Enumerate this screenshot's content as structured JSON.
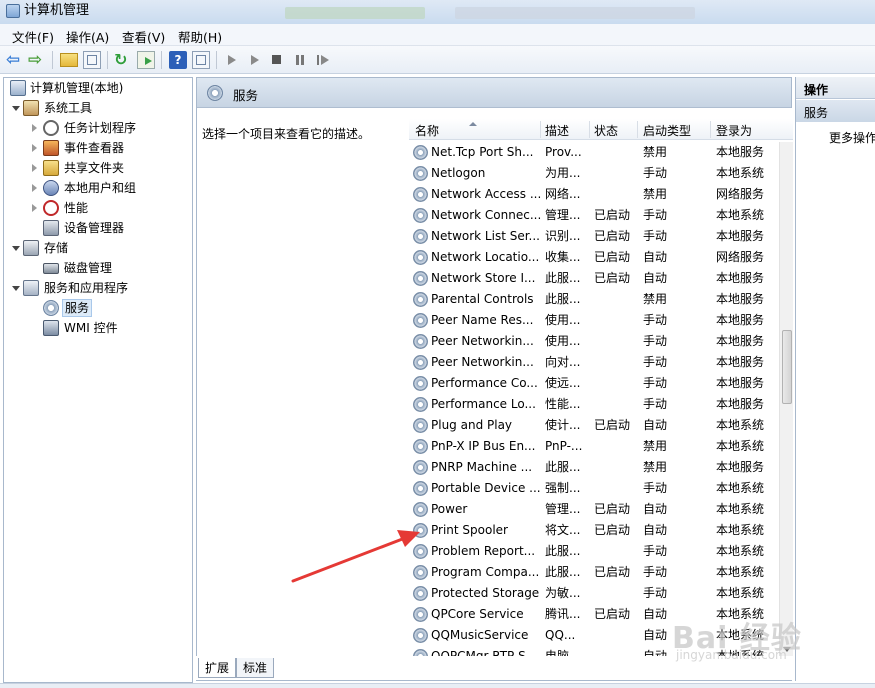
{
  "window": {
    "title": "计算机管理"
  },
  "menu": [
    "文件(F)",
    "操作(A)",
    "查看(V)",
    "帮助(H)"
  ],
  "toolbar": {
    "icons": [
      "back-icon",
      "forward-icon",
      "up-folder-icon",
      "show-hide-tree-icon",
      "refresh-icon",
      "export-list-icon",
      "help-icon",
      "show-hide-action-pane-icon",
      "start-service-icon",
      "start-service-icon",
      "stop-service-icon",
      "pause-service-icon",
      "restart-service-icon"
    ]
  },
  "tree": [
    {
      "label": "计算机管理(本地)",
      "level": 0,
      "icon": "computer-icon",
      "toggle": "none"
    },
    {
      "label": "系统工具",
      "level": 1,
      "icon": "tools-icon",
      "toggle": "open"
    },
    {
      "label": "任务计划程序",
      "level": 2,
      "icon": "clock-icon",
      "toggle": "closed"
    },
    {
      "label": "事件查看器",
      "level": 2,
      "icon": "event-viewer-icon",
      "toggle": "closed"
    },
    {
      "label": "共享文件夹",
      "level": 2,
      "icon": "shared-folder-icon",
      "toggle": "closed"
    },
    {
      "label": "本地用户和组",
      "level": 2,
      "icon": "users-icon",
      "toggle": "closed"
    },
    {
      "label": "性能",
      "level": 2,
      "icon": "performance-icon",
      "toggle": "closed"
    },
    {
      "label": "设备管理器",
      "level": 2,
      "icon": "device-manager-icon",
      "toggle": "none"
    },
    {
      "label": "存储",
      "level": 1,
      "icon": "storage-icon",
      "toggle": "open"
    },
    {
      "label": "磁盘管理",
      "level": 2,
      "icon": "disk-icon",
      "toggle": "none"
    },
    {
      "label": "服务和应用程序",
      "level": 1,
      "icon": "services-apps-icon",
      "toggle": "open"
    },
    {
      "label": "服务",
      "level": 2,
      "icon": "gear-icon",
      "toggle": "none",
      "selected": true
    },
    {
      "label": "WMI 控件",
      "level": 2,
      "icon": "wmi-icon",
      "toggle": "none"
    }
  ],
  "panel": {
    "title": "服务",
    "description": "选择一个项目来查看它的描述。"
  },
  "columns": [
    "名称",
    "描述",
    "状态",
    "启动类型",
    "登录为"
  ],
  "services": [
    [
      "Net.Tcp Port Sh...",
      "Prov...",
      "",
      "禁用",
      "本地服务"
    ],
    [
      "Netlogon",
      "为用...",
      "",
      "手动",
      "本地系统"
    ],
    [
      "Network Access ...",
      "网络...",
      "",
      "禁用",
      "网络服务"
    ],
    [
      "Network Connec...",
      "管理...",
      "已启动",
      "手动",
      "本地系统"
    ],
    [
      "Network List Ser...",
      "识别...",
      "已启动",
      "手动",
      "本地服务"
    ],
    [
      "Network Locatio...",
      "收集...",
      "已启动",
      "自动",
      "网络服务"
    ],
    [
      "Network Store I...",
      "此服...",
      "已启动",
      "自动",
      "本地服务"
    ],
    [
      "Parental Controls",
      "此服...",
      "",
      "禁用",
      "本地服务"
    ],
    [
      "Peer Name Res...",
      "使用...",
      "",
      "手动",
      "本地服务"
    ],
    [
      "Peer Networkin...",
      "使用...",
      "",
      "手动",
      "本地服务"
    ],
    [
      "Peer Networkin...",
      "向对...",
      "",
      "手动",
      "本地服务"
    ],
    [
      "Performance Co...",
      "使远...",
      "",
      "手动",
      "本地服务"
    ],
    [
      "Performance Lo...",
      "性能...",
      "",
      "手动",
      "本地服务"
    ],
    [
      "Plug and Play",
      "使计...",
      "已启动",
      "自动",
      "本地系统"
    ],
    [
      "PnP-X IP Bus En...",
      "PnP-...",
      "",
      "禁用",
      "本地系统"
    ],
    [
      "PNRP Machine ...",
      "此服...",
      "",
      "禁用",
      "本地服务"
    ],
    [
      "Portable Device ...",
      "强制...",
      "",
      "手动",
      "本地系统"
    ],
    [
      "Power",
      "管理...",
      "已启动",
      "自动",
      "本地系统"
    ],
    [
      "Print Spooler",
      "将文...",
      "已启动",
      "自动",
      "本地系统"
    ],
    [
      "Problem Report...",
      "此服...",
      "",
      "手动",
      "本地系统"
    ],
    [
      "Program Compa...",
      "此服...",
      "已启动",
      "手动",
      "本地系统"
    ],
    [
      "Protected Storage",
      "为敏...",
      "",
      "手动",
      "本地系统"
    ],
    [
      "QPCore Service",
      "腾讯...",
      "已启动",
      "自动",
      "本地系统"
    ],
    [
      "QQMusicService",
      "QQ...",
      "",
      "自动",
      "本地系统"
    ],
    [
      "QQPCMgr RTP S...",
      "电脑...",
      "",
      "自动",
      "本地系统"
    ]
  ],
  "tabs": [
    "扩展",
    "标准"
  ],
  "actions": {
    "header": "操作",
    "section": "服务",
    "more": "更多操作"
  },
  "watermark": {
    "brand": "Bai 经验",
    "url": "jingyan.baidu.com"
  },
  "colors": {
    "annotation_arrow": "#e53935",
    "selection": "#dceaf8",
    "header_gradient": "#c7d4e3"
  }
}
